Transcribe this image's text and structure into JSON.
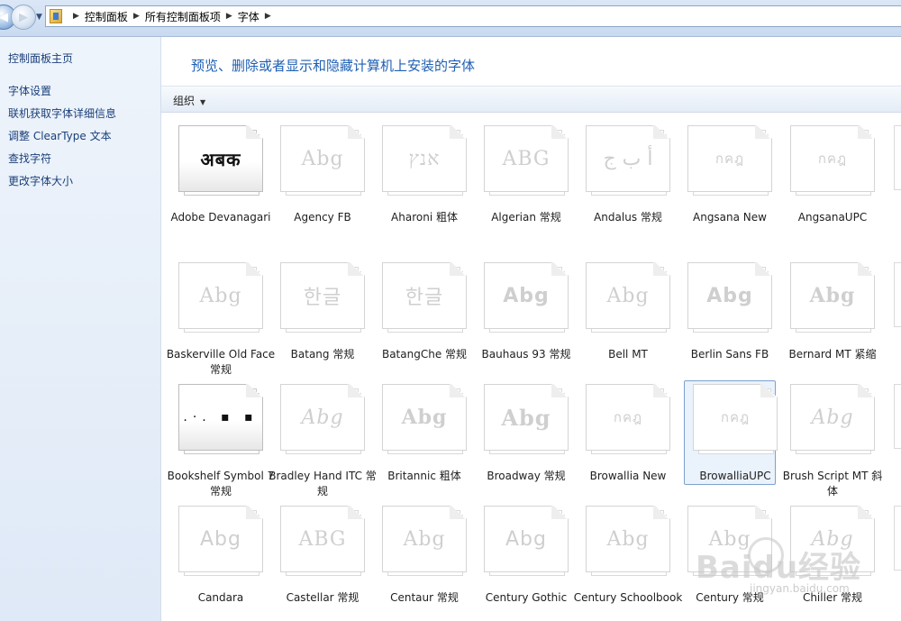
{
  "address_bar": {
    "breadcrumbs": [
      "控制面板",
      "所有控制面板项",
      "字体"
    ]
  },
  "sidebar": {
    "home": "控制面板主页",
    "links": [
      "字体设置",
      "联机获取字体详细信息",
      "调整 ClearType 文本",
      "查找字符",
      "更改字体大小"
    ]
  },
  "main": {
    "title": "预览、删除或者显示和隐藏计算机上安装的字体",
    "toolbar": {
      "organize": "组织"
    }
  },
  "fonts": [
    {
      "name": "Adobe Devanagari",
      "sample": "अबक"
    },
    {
      "name": "Agency FB",
      "sample": "Abg"
    },
    {
      "name": "Aharoni 粗体",
      "sample": "אנץ"
    },
    {
      "name": "Algerian 常规",
      "sample": "ABG"
    },
    {
      "name": "Andalus 常规",
      "sample": "أ ب ج"
    },
    {
      "name": "Angsana New",
      "sample": "กคฎ"
    },
    {
      "name": "AngsanaUPC",
      "sample": "กคฎ"
    },
    {
      "name": "Baskerville Old Face 常规",
      "sample": "Abg"
    },
    {
      "name": "Batang 常规",
      "sample": "한글"
    },
    {
      "name": "BatangChe 常规",
      "sample": "한글"
    },
    {
      "name": "Bauhaus 93 常规",
      "sample": "Abg"
    },
    {
      "name": "Bell MT",
      "sample": "Abg"
    },
    {
      "name": "Berlin Sans FB",
      "sample": "Abg"
    },
    {
      "name": "Bernard MT 紧缩",
      "sample": "Abg"
    },
    {
      "name": "Bookshelf Symbol 7 常规",
      "sample": ".·. ▪ ▪"
    },
    {
      "name": "Bradley Hand ITC 常规",
      "sample": "Abg"
    },
    {
      "name": "Britannic 粗体",
      "sample": "Abg"
    },
    {
      "name": "Broadway 常规",
      "sample": "Abg"
    },
    {
      "name": "Browallia New",
      "sample": "กคฎ"
    },
    {
      "name": "BrowalliaUPC",
      "sample": "กคฎ"
    },
    {
      "name": "Brush Script MT 斜体",
      "sample": "Abg"
    },
    {
      "name": "Candara",
      "sample": "Abg"
    },
    {
      "name": "Castellar 常规",
      "sample": "ABG"
    },
    {
      "name": "Centaur 常规",
      "sample": "Abg"
    },
    {
      "name": "Century Gothic",
      "sample": "Abg"
    },
    {
      "name": "Century Schoolbook",
      "sample": "Abg"
    },
    {
      "name": "Century 常规",
      "sample": "Abg"
    },
    {
      "name": "Chiller 常规",
      "sample": "Abg"
    }
  ],
  "watermark": {
    "text": "Baidu经验",
    "sub": "jingyan.baidu.com"
  }
}
